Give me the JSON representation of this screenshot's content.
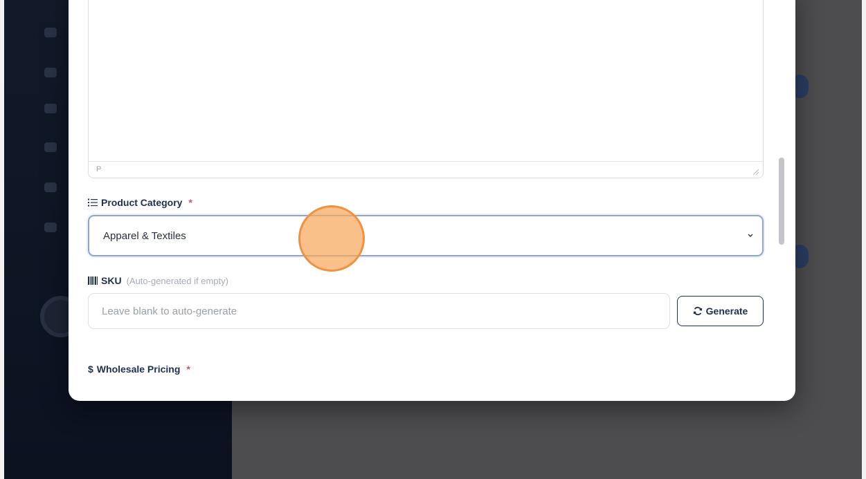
{
  "editor": {
    "status_path": "P"
  },
  "category": {
    "label": "Product Category",
    "required_mark": "*",
    "selected_value": "Apparel & Textiles"
  },
  "sku": {
    "label": "SKU",
    "hint": "(Auto-generated if empty)",
    "placeholder": "Leave blank to auto-generate",
    "generate_label": "Generate"
  },
  "pricing": {
    "label": "Wholesale Pricing",
    "icon_glyph": "$",
    "required_mark": "*"
  },
  "icons": {
    "category": "list-icon",
    "sku": "barcode-icon",
    "generate": "refresh-icon",
    "select": "chevron-down-icon"
  },
  "colors": {
    "accent": "#1f2f52",
    "required": "#e0525c",
    "focus_border": "#8ea4d6",
    "cursor": "#f0913f"
  }
}
